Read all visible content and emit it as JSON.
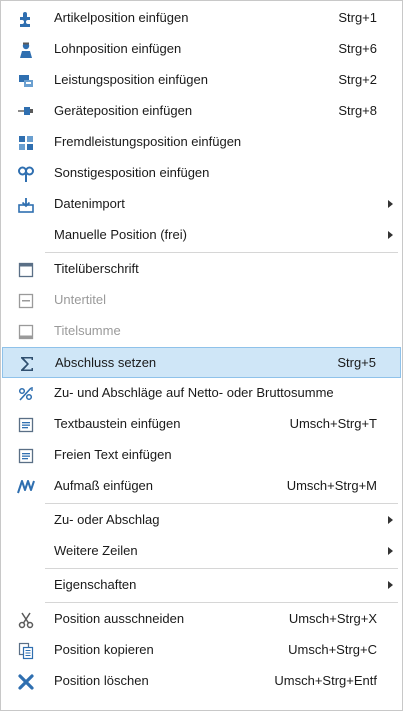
{
  "colors": {
    "highlight_bg": "#cfe6f7",
    "highlight_border": "#8fc2ea",
    "icon_blue": "#2f6fb0",
    "disabled_text": "#9a9a9a"
  },
  "menu": {
    "items": [
      {
        "label": "Artikelposition einfügen",
        "shortcut": "Strg+1",
        "icon": "puzzle-icon"
      },
      {
        "label": "Lohnposition einfügen",
        "shortcut": "Strg+6",
        "icon": "worker-icon"
      },
      {
        "label": "Leistungsposition einfügen",
        "shortcut": "Strg+2",
        "icon": "service-icon"
      },
      {
        "label": "Geräteposition einfügen",
        "shortcut": "Strg+8",
        "icon": "device-icon"
      },
      {
        "label": "Fremdleistungsposition einfügen",
        "shortcut": "",
        "icon": "external-service-icon"
      },
      {
        "label": "Sonstigesposition einfügen",
        "shortcut": "",
        "icon": "misc-icon"
      },
      {
        "label": "Datenimport",
        "shortcut": "",
        "icon": "import-icon",
        "submenu": true
      },
      {
        "label": "Manuelle Position (frei)",
        "shortcut": "",
        "icon": "",
        "submenu": true
      },
      {
        "label": "Titelüberschrift",
        "shortcut": "",
        "icon": "title-heading-icon"
      },
      {
        "label": "Untertitel",
        "shortcut": "",
        "icon": "subtitle-icon",
        "disabled": true
      },
      {
        "label": "Titelsumme",
        "shortcut": "",
        "icon": "title-sum-icon",
        "disabled": true
      },
      {
        "label": "Abschluss setzen",
        "shortcut": "Strg+5",
        "icon": "sigma-icon",
        "highlighted": true
      },
      {
        "label": "Zu- und Abschläge auf Netto- oder Bruttosumme",
        "shortcut": "",
        "icon": "percent-icon"
      },
      {
        "label": "Textbaustein einfügen",
        "shortcut": "Umsch+Strg+T",
        "icon": "text-block-icon"
      },
      {
        "label": "Freien Text einfügen",
        "shortcut": "",
        "icon": "free-text-icon"
      },
      {
        "label": "Aufmaß einfügen",
        "shortcut": "Umsch+Strg+M",
        "icon": "measurement-icon"
      },
      {
        "label": "Zu- oder Abschlag",
        "shortcut": "",
        "icon": "",
        "submenu": true
      },
      {
        "label": "Weitere Zeilen",
        "shortcut": "",
        "icon": "",
        "submenu": true
      },
      {
        "label": "Eigenschaften",
        "shortcut": "",
        "icon": "",
        "submenu": true
      },
      {
        "label": "Position ausschneiden",
        "shortcut": "Umsch+Strg+X",
        "icon": "scissors-icon"
      },
      {
        "label": "Position kopieren",
        "shortcut": "Umsch+Strg+C",
        "icon": "copy-icon"
      },
      {
        "label": "Position löschen",
        "shortcut": "Umsch+Strg+Entf",
        "icon": "delete-icon"
      }
    ]
  }
}
